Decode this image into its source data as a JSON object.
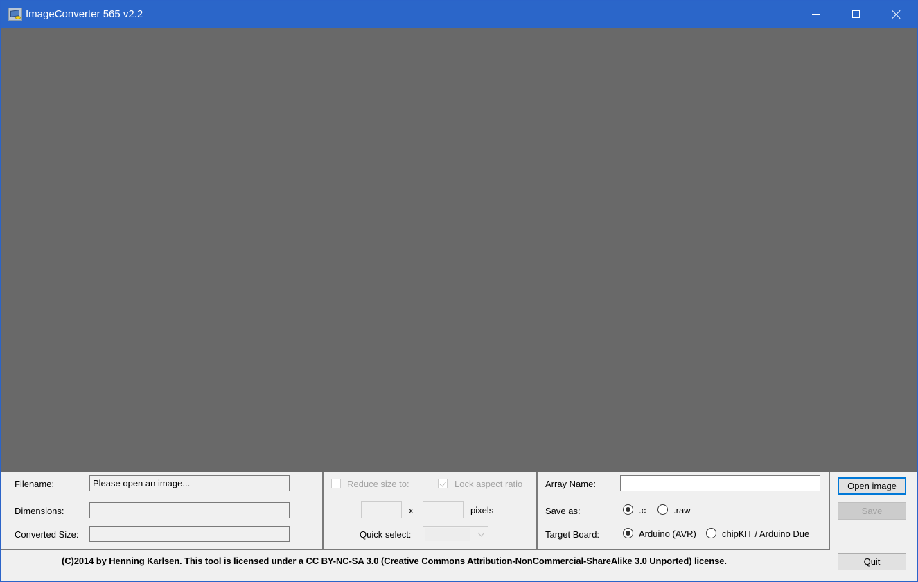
{
  "window": {
    "title": "ImageConverter 565 v2.2",
    "controls": {
      "minimize": "minimize-icon",
      "maximize": "maximize-icon",
      "close": "close-icon"
    },
    "accent": "#2b66c9",
    "preview_bg": "#696969"
  },
  "file_info": {
    "filename_label": "Filename:",
    "filename_value": "Please open an image...",
    "dimensions_label": "Dimensions:",
    "dimensions_value": "",
    "converted_size_label": "Converted Size:",
    "converted_size_value": ""
  },
  "resize": {
    "reduce_label": "Reduce size to:",
    "reduce_checked": false,
    "lock_label": "Lock aspect ratio",
    "lock_checked": true,
    "width_value": "",
    "x_label": "x",
    "height_value": "",
    "pixels_label": "pixels",
    "quick_select_label": "Quick select:",
    "quick_select_value": ""
  },
  "output": {
    "array_name_label": "Array Name:",
    "array_name_value": "",
    "save_as_label": "Save as:",
    "save_as_options": [
      {
        "label": ".c",
        "selected": true
      },
      {
        "label": ".raw",
        "selected": false
      }
    ],
    "target_board_label": "Target Board:",
    "target_board_options": [
      {
        "label": "Arduino (AVR)",
        "selected": true
      },
      {
        "label": "chipKIT / Arduino Due",
        "selected": false
      }
    ]
  },
  "buttons": {
    "open_image": "Open image",
    "save": "Save",
    "quit": "Quit"
  },
  "footer": {
    "license_text": "(C)2014 by Henning Karlsen. This tool is licensed under a CC BY-NC-SA 3.0 (Creative Commons Attribution-NonCommercial-ShareAlike 3.0 Unported) license."
  }
}
